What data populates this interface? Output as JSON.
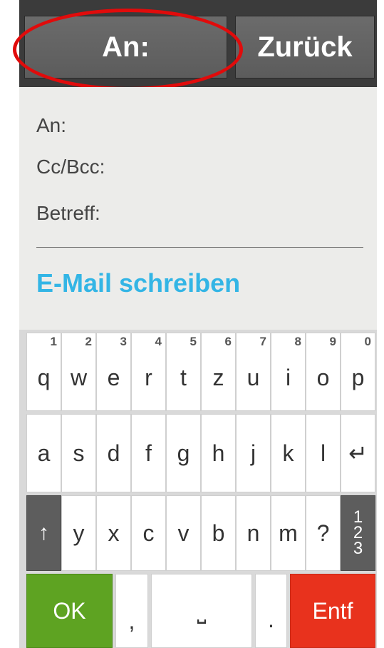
{
  "header": {
    "to_button": "An:",
    "back_button": "Zurück"
  },
  "form": {
    "to_label": "An:",
    "cc_label": "Cc/Bcc:",
    "subject_label": "Betreff:",
    "compose_label": "E-Mail schreiben"
  },
  "keyboard": {
    "row1": [
      {
        "letter": "q",
        "num": "1"
      },
      {
        "letter": "w",
        "num": "2"
      },
      {
        "letter": "e",
        "num": "3"
      },
      {
        "letter": "r",
        "num": "4"
      },
      {
        "letter": "t",
        "num": "5"
      },
      {
        "letter": "z",
        "num": "6"
      },
      {
        "letter": "u",
        "num": "7"
      },
      {
        "letter": "i",
        "num": "8"
      },
      {
        "letter": "o",
        "num": "9"
      },
      {
        "letter": "p",
        "num": "0"
      }
    ],
    "row2": [
      "a",
      "s",
      "d",
      "f",
      "g",
      "h",
      "j",
      "k",
      "l",
      "↵"
    ],
    "row3": {
      "shift": "↑",
      "letters": [
        "y",
        "x",
        "c",
        "v",
        "b",
        "n",
        "m",
        "?"
      ],
      "numtoggle": [
        "1",
        "2",
        "3"
      ]
    },
    "row4": {
      "ok": "OK",
      "comma": ",",
      "space": "⎵",
      "period": ".",
      "delete": "Entf"
    }
  },
  "colors": {
    "accent": "#33b5e5",
    "ok": "#5ea322",
    "delete": "#e8321d",
    "highlight": "#e10b0b"
  }
}
